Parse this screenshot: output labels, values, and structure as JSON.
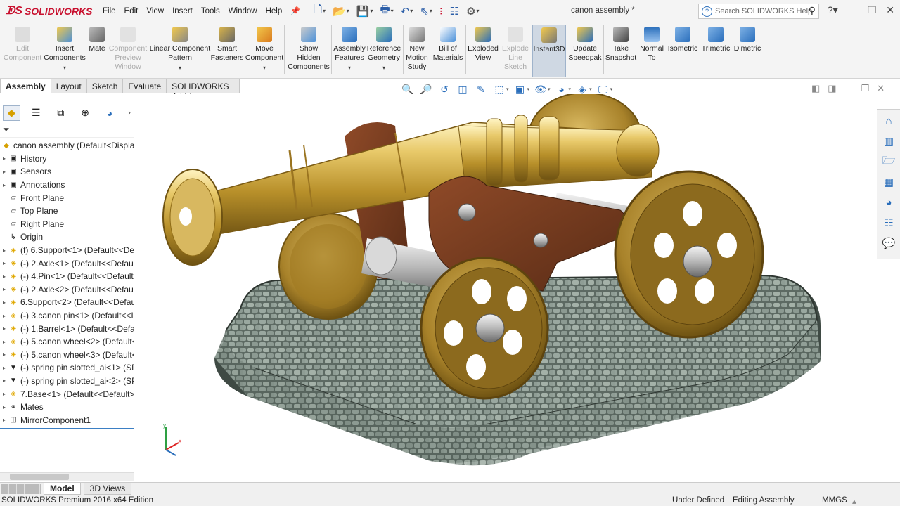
{
  "app": {
    "logo_text": "SOLIDWORKS",
    "doc_title": "canon assembly *"
  },
  "menu": [
    "File",
    "Edit",
    "View",
    "Insert",
    "Tools",
    "Window",
    "Help"
  ],
  "search": {
    "placeholder": "Search SOLIDWORKS Help"
  },
  "ribbon": [
    {
      "label": "Edit\nComponent",
      "enabled": false
    },
    {
      "label": "Insert\nComponents",
      "enabled": true
    },
    {
      "label": "Mate",
      "enabled": true
    },
    {
      "label": "Component\nPreview\nWindow",
      "enabled": false
    },
    {
      "label": "Linear Component\nPattern",
      "enabled": true
    },
    {
      "label": "Smart\nFasteners",
      "enabled": true
    },
    {
      "label": "Move\nComponent",
      "enabled": true
    },
    {
      "label": "Show\nHidden\nComponents",
      "enabled": true
    },
    {
      "label": "Assembly\nFeatures",
      "enabled": true
    },
    {
      "label": "Reference\nGeometry",
      "enabled": true
    },
    {
      "label": "New\nMotion\nStudy",
      "enabled": true
    },
    {
      "label": "Bill of\nMaterials",
      "enabled": true
    },
    {
      "label": "Exploded\nView",
      "enabled": true
    },
    {
      "label": "Explode\nLine\nSketch",
      "enabled": false
    },
    {
      "label": "Instant3D",
      "enabled": true
    },
    {
      "label": "Update\nSpeedpak",
      "enabled": true
    },
    {
      "label": "Take\nSnapshot",
      "enabled": true
    },
    {
      "label": "Normal\nTo",
      "enabled": true
    },
    {
      "label": "Isometric",
      "enabled": true
    },
    {
      "label": "Trimetric",
      "enabled": true
    },
    {
      "label": "Dimetric",
      "enabled": true
    }
  ],
  "cmd_tabs": [
    "Assembly",
    "Layout",
    "Sketch",
    "Evaluate",
    "SOLIDWORKS Add-Ins"
  ],
  "tree": [
    {
      "label": "canon assembly  (Default<Display",
      "type": "root"
    },
    {
      "label": "History",
      "type": "folder"
    },
    {
      "label": "Sensors",
      "type": "folder"
    },
    {
      "label": "Annotations",
      "type": "folder"
    },
    {
      "label": "Front Plane",
      "type": "plane"
    },
    {
      "label": "Top Plane",
      "type": "plane"
    },
    {
      "label": "Right Plane",
      "type": "plane"
    },
    {
      "label": "Origin",
      "type": "origin"
    },
    {
      "label": "(f) 6.Support<1> (Default<<De",
      "type": "part"
    },
    {
      "label": "(-) 2.Axle<1> (Default<<Default",
      "type": "part"
    },
    {
      "label": "(-) 4.Pin<1> (Default<<Default",
      "type": "part"
    },
    {
      "label": "(-) 2.Axle<2> (Default<<Default",
      "type": "part"
    },
    {
      "label": "6.Support<2> (Default<<Defau",
      "type": "part"
    },
    {
      "label": "(-) 3.canon pin<1> (Default<<I",
      "type": "part"
    },
    {
      "label": "(-) 1.Barrel<1> (Default<<Defa",
      "type": "part"
    },
    {
      "label": "(-) 5.canon wheel<2> (Default<",
      "type": "part"
    },
    {
      "label": "(-) 5.canon wheel<3> (Default<",
      "type": "part"
    },
    {
      "label": "(-) spring pin slotted_ai<1> (SP",
      "type": "pin"
    },
    {
      "label": "(-) spring pin slotted_ai<2> (SP",
      "type": "pin"
    },
    {
      "label": "7.Base<1> (Default<<Default>",
      "type": "part"
    },
    {
      "label": "Mates",
      "type": "mates"
    },
    {
      "label": "MirrorComponent1",
      "type": "mirror"
    }
  ],
  "bottom_tabs": [
    "Model",
    "3D Views"
  ],
  "status": {
    "edition": "SOLIDWORKS Premium 2016 x64 Edition",
    "defined": "Under Defined",
    "mode": "Editing Assembly",
    "units": "MMGS"
  },
  "colors": {
    "accent": "#2a6ebb",
    "brass": "#d4b04a",
    "wood": "#7a3e22",
    "stone": "#7e8f86"
  }
}
